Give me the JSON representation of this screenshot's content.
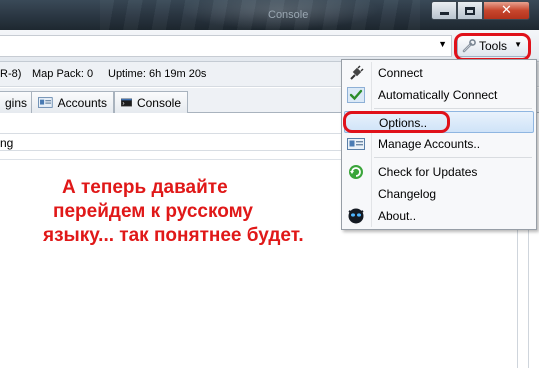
{
  "window": {
    "title": "Console",
    "minimize_glyph": "",
    "close_glyph": "✕"
  },
  "toolbar": {
    "tools_label": "Tools",
    "tools_icon": "wrench-icon",
    "dropdown_arrow": "▼",
    "tools_caret": "▼"
  },
  "status": {
    "fragment": "R-8)",
    "map_pack": "Map Pack: 0",
    "uptime": "Uptime: 6h 19m 20s"
  },
  "tabs": [
    {
      "label": "gins",
      "icon": ""
    },
    {
      "label": "Accounts",
      "icon": "accounts-icon"
    },
    {
      "label": "Console",
      "icon": "console-icon"
    }
  ],
  "content": {
    "column_header_fragment": "ng"
  },
  "annotation": {
    "lines": [
      "А теперь давайте",
      "перейдем к русскому",
      "языку... так понятнее будет."
    ],
    "color": "#e01818"
  },
  "menu": {
    "items": [
      {
        "label": "Connect",
        "icon": "plug-icon"
      },
      {
        "label": "Automatically Connect",
        "icon": "checkmark-icon",
        "checked": true
      },
      {
        "label": "Options..",
        "icon": "",
        "selected": true
      },
      {
        "label": "Manage Accounts..",
        "icon": "accounts-card-icon"
      },
      {
        "label": "Check for Updates",
        "icon": "update-icon"
      },
      {
        "label": "Changelog",
        "icon": ""
      },
      {
        "label": "About..",
        "icon": "app-logo-icon"
      }
    ]
  },
  "colors": {
    "highlight_red": "#e0111a",
    "menu_selection": "#cfe3f8"
  }
}
